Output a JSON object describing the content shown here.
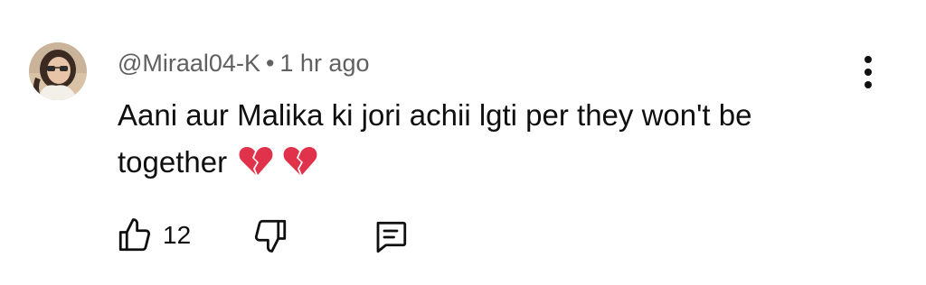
{
  "comment": {
    "author": "@Miraal04-K",
    "separator": "•",
    "time": "1 hr ago",
    "text": "Aani aur Malika ki jori achii lgti per they won't be together",
    "emojis": [
      "broken-heart",
      "broken-heart"
    ],
    "like_count": "12"
  },
  "icons": {
    "like": "thumbs-up-icon",
    "dislike": "thumbs-down-icon",
    "reply": "comment-icon",
    "menu": "more-vertical-icon"
  },
  "colors": {
    "text": "#0f0f0f",
    "meta": "#606060",
    "emoji": "#e0324a"
  }
}
